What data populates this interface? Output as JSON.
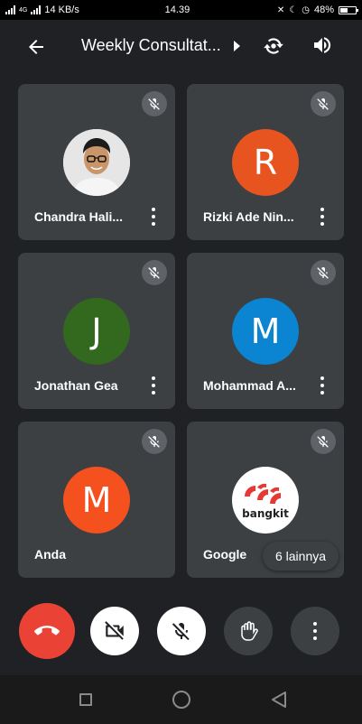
{
  "status_bar": {
    "network_label": "4G",
    "speed": "14 KB/s",
    "time": "14.39",
    "battery": "48%",
    "battery_level": 0.48
  },
  "header": {
    "title": "Weekly Consultat..."
  },
  "participants": [
    {
      "name": "Chandra Hali...",
      "initial": "",
      "avatar_type": "photo",
      "color": "#e8e8e8",
      "muted": true
    },
    {
      "name": "Rizki Ade Nin...",
      "initial": "R",
      "avatar_type": "letter",
      "color": "#e8541f",
      "muted": true
    },
    {
      "name": "Jonathan Gea",
      "initial": "J",
      "avatar_type": "letter",
      "color": "#33691e",
      "muted": true
    },
    {
      "name": "Mohammad A...",
      "initial": "M",
      "avatar_type": "letter",
      "color": "#0b84d1",
      "muted": true
    },
    {
      "name": "Anda",
      "initial": "M",
      "avatar_type": "letter",
      "color": "#f4511e",
      "muted": true
    },
    {
      "name": "Google",
      "initial": "",
      "avatar_type": "logo",
      "logo_text": "bangkit",
      "color": "#ffffff",
      "muted": true
    }
  ],
  "more_participants": "6 lainnya",
  "controls": {
    "end_call": "phone-hangup-icon",
    "video": "video-off-icon",
    "mic": "mic-off-icon",
    "raise_hand": "hand-icon",
    "more": "more-vertical-icon"
  },
  "colors": {
    "background": "#202124",
    "tile": "#3c4043",
    "end_call": "#ea4335"
  }
}
